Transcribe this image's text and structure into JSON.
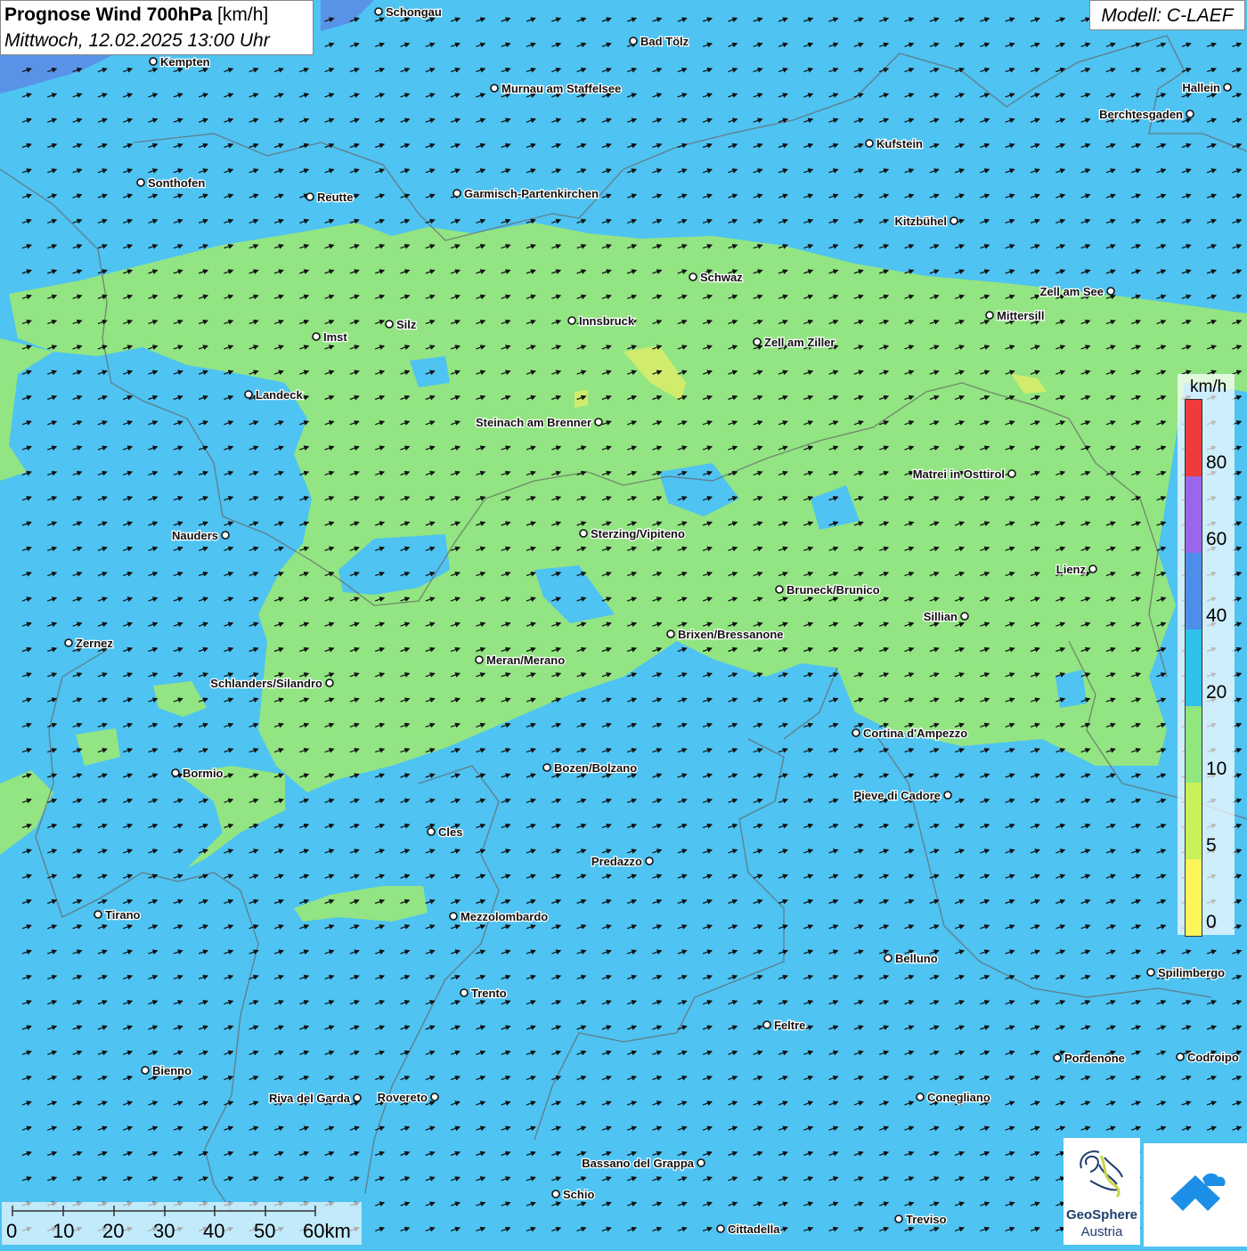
{
  "title": {
    "bold": "Prognose Wind 700hPa",
    "unit": " [km/h]",
    "datetime": "Mittwoch, 12.02.2025 13:00 Uhr"
  },
  "model": "Modell: C-LAEF",
  "legend": {
    "unit": "km/h",
    "labels": [
      "80",
      "60",
      "40",
      "20",
      "10",
      "5",
      "0"
    ],
    "colors": [
      "#ef3b3b",
      "#9b67ea",
      "#4d8fe8",
      "#2fc0ec",
      "#90e77d",
      "#c8f05a",
      "#fcf65a"
    ]
  },
  "scale": {
    "labels": [
      "0",
      "10",
      "20",
      "30",
      "40",
      "50",
      "60km"
    ]
  },
  "logo": {
    "line1": "GeoSphere",
    "line2": "Austria"
  },
  "colors": {
    "water_blue": "#4fc3f2",
    "calm_green": "#92e582",
    "yellow": "#d8ec6a",
    "dark_blue": "#5b8be6"
  },
  "cities": [
    {
      "name": "Schongau"
    },
    {
      "name": "Bad Tölz"
    },
    {
      "name": "Kempten"
    },
    {
      "name": "Murnau am Staffelsee"
    },
    {
      "name": "Hallein"
    },
    {
      "name": "Berchtesgaden"
    },
    {
      "name": "Kufstein"
    },
    {
      "name": "Sonthofen"
    },
    {
      "name": "Reutte"
    },
    {
      "name": "Garmisch-Partenkirchen"
    },
    {
      "name": "Kitzbühel"
    },
    {
      "name": "Schwaz"
    },
    {
      "name": "Zell am See"
    },
    {
      "name": "Mittersill"
    },
    {
      "name": "Innsbruck"
    },
    {
      "name": "Silz"
    },
    {
      "name": "Imst"
    },
    {
      "name": "Zell am Ziller"
    },
    {
      "name": "Landeck"
    },
    {
      "name": "Steinach am Brenner"
    },
    {
      "name": "Matrei in Osttirol"
    },
    {
      "name": "Nauders"
    },
    {
      "name": "Sterzing/Vipiteno"
    },
    {
      "name": "Lienz"
    },
    {
      "name": "Bruneck/Brunico"
    },
    {
      "name": "Sillian"
    },
    {
      "name": "Zernez"
    },
    {
      "name": "Brixen/Bressanone"
    },
    {
      "name": "Meran/Merano"
    },
    {
      "name": "Schlanders/Silandro"
    },
    {
      "name": "Cortina d'Ampezzo"
    },
    {
      "name": "Bozen/Bolzano"
    },
    {
      "name": "Bormio"
    },
    {
      "name": "Pieve di Cadore"
    },
    {
      "name": "Cles"
    },
    {
      "name": "Predazzo"
    },
    {
      "name": "Tirano"
    },
    {
      "name": "Mezzolombardo"
    },
    {
      "name": "Belluno"
    },
    {
      "name": "Spilimbergo"
    },
    {
      "name": "Trento"
    },
    {
      "name": "Feltre"
    },
    {
      "name": "Pordenone"
    },
    {
      "name": "Codroipo"
    },
    {
      "name": "Bienno"
    },
    {
      "name": "Riva del Garda"
    },
    {
      "name": "Rovereto"
    },
    {
      "name": "Conegliano"
    },
    {
      "name": "Bassano del Grappa"
    },
    {
      "name": "Schio"
    },
    {
      "name": "Treviso"
    },
    {
      "name": "Cittadella"
    }
  ]
}
